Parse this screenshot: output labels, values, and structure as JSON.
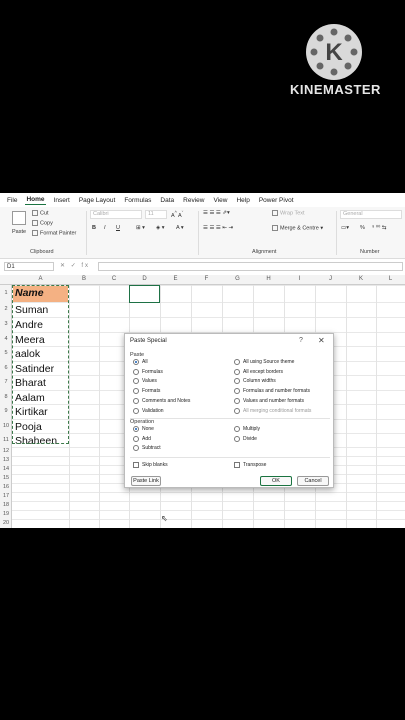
{
  "watermark": {
    "logo_letter": "K",
    "brand": "KINEMASTER"
  },
  "ribbon": {
    "tabs": [
      "File",
      "Home",
      "Insert",
      "Page Layout",
      "Formulas",
      "Data",
      "Review",
      "View",
      "Help",
      "Power Pivot"
    ],
    "active_tab": "Home",
    "clipboard": {
      "paste": "Paste",
      "cut": "Cut",
      "copy": "Copy",
      "format_painter": "Format Painter",
      "label": "Clipboard"
    },
    "font": {
      "name": "Calibri",
      "size": "11",
      "bold": "B",
      "italic": "I",
      "underline": "U"
    },
    "alignment": {
      "wrap": "Wrap Text",
      "merge": "Merge & Centre",
      "label": "Alignment"
    },
    "number": {
      "format": "General",
      "percent": "%",
      "label": "Number"
    }
  },
  "formula_bar": {
    "name_box": "D1",
    "fx": "✕ ✓ fx",
    "value": ""
  },
  "columns": [
    "A",
    "B",
    "C",
    "D",
    "E",
    "F",
    "G",
    "H",
    "I",
    "J",
    "K",
    "L"
  ],
  "rows": [
    "1",
    "2",
    "3",
    "4",
    "5",
    "6",
    "7",
    "8",
    "9",
    "10",
    "11",
    "12",
    "13",
    "14",
    "15",
    "16",
    "17",
    "18",
    "19",
    "20"
  ],
  "cells_a": [
    "Name",
    "Suman",
    "Andre",
    "Meera",
    "aalok",
    "Satinder",
    "Bharat",
    "Aalam",
    "Kirtikar",
    "Pooja",
    "Shaheen"
  ],
  "dialog": {
    "title": "Paste Special",
    "help": "?",
    "close": "✕",
    "paste_label": "Paste",
    "paste_left": [
      "All",
      "Formulas",
      "Values",
      "Formats",
      "Comments and Notes",
      "Validation"
    ],
    "paste_right": [
      "All using Source theme",
      "All except borders",
      "Column widths",
      "Formulas and number formats",
      "Values and number formats",
      "All merging conditional formats"
    ],
    "operation_label": "Operation",
    "op_left": [
      "None",
      "Add",
      "Subtract"
    ],
    "op_right": [
      "Multiply",
      "Divide"
    ],
    "skip_blanks": "Skip blanks",
    "transpose": "Transpose",
    "paste_link": "Paste Link",
    "ok": "OK",
    "cancel": "Cancel"
  }
}
